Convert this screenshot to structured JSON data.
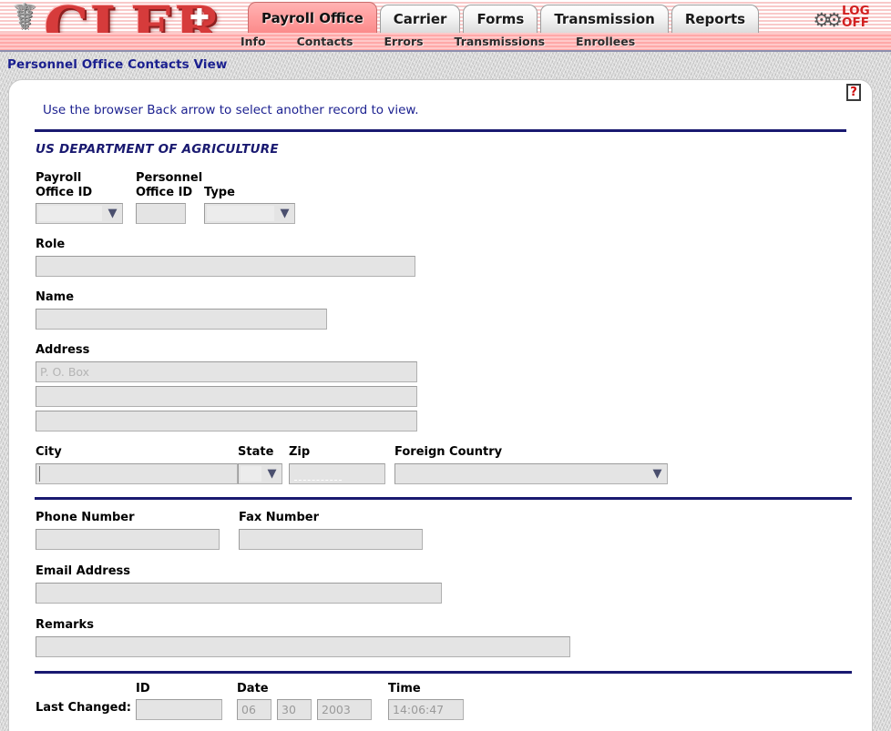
{
  "header": {
    "logo_text": "CLER",
    "caduceus_icon": "caduceus-icon",
    "cross_icon": "medical-cross-icon",
    "gear_icon": "gear-icon",
    "logoff_line1": "LOG",
    "logoff_line2": "OFF",
    "tabs": [
      {
        "label": "Payroll Office",
        "active": true
      },
      {
        "label": "Carrier",
        "active": false
      },
      {
        "label": "Forms",
        "active": false
      },
      {
        "label": "Transmission",
        "active": false
      },
      {
        "label": "Reports",
        "active": false
      }
    ],
    "subnav": [
      {
        "label": "Info"
      },
      {
        "label": "Contacts"
      },
      {
        "label": "Errors"
      },
      {
        "label": "Transmissions"
      },
      {
        "label": "Enrollees"
      }
    ]
  },
  "page": {
    "title": "Personnel Office Contacts View",
    "notice": "Use the browser Back arrow to select another record to view.",
    "help_icon_label": "?"
  },
  "form": {
    "agency": "US DEPARTMENT OF AGRICULTURE",
    "payroll_office_id": {
      "label": "Payroll\nOffice ID",
      "value": ""
    },
    "personnel_office_id": {
      "label": "Personnel\nOffice ID",
      "value": ""
    },
    "type": {
      "label": "Type",
      "value": ""
    },
    "role": {
      "label": "Role",
      "value": ""
    },
    "name": {
      "label": "Name",
      "value": ""
    },
    "address": {
      "label": "Address",
      "line1_placeholder": "P. O. Box",
      "line1": "",
      "line2": "",
      "line3": ""
    },
    "city": {
      "label": "City",
      "value": ""
    },
    "state": {
      "label": "State",
      "value": ""
    },
    "zip": {
      "label": "Zip",
      "value": ""
    },
    "foreign_country": {
      "label": "Foreign Country",
      "value": ""
    },
    "phone_number": {
      "label": "Phone Number",
      "value": ""
    },
    "fax_number": {
      "label": "Fax Number",
      "value": ""
    },
    "email_address": {
      "label": "Email Address",
      "value": ""
    },
    "remarks": {
      "label": "Remarks",
      "value": ""
    },
    "last_changed": {
      "label": "Last Changed:",
      "id_label": "ID",
      "id_value": "",
      "date_label": "Date",
      "date_month": "06",
      "date_day": "30",
      "date_year": "2003",
      "time_label": "Time",
      "time_value": "14:06:47"
    }
  },
  "colors": {
    "navy": "#191970",
    "accent_red": "#d21f1f",
    "tab_active": "#ff9e9e"
  }
}
